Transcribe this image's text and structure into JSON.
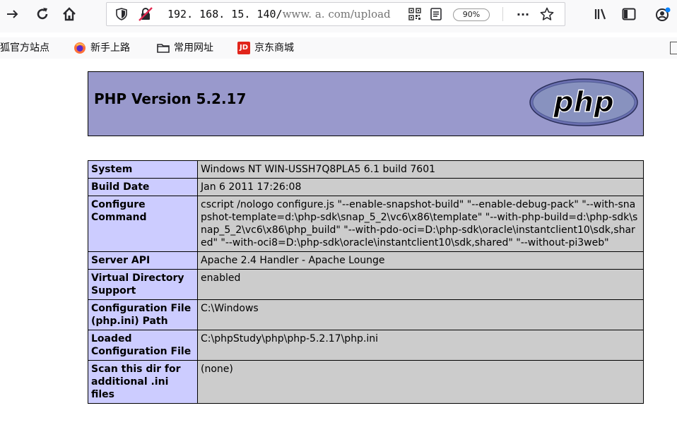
{
  "toolbar": {
    "url_host": "192. 168. 15. 140/",
    "url_path": "www. a. com/upload",
    "zoom": "90%",
    "more_label": "···"
  },
  "bookmarks": [
    {
      "label": "狐官方站点",
      "icon": "none"
    },
    {
      "label": "新手上路",
      "icon": "firefox-icon"
    },
    {
      "label": "常用网址",
      "icon": "folder-icon"
    },
    {
      "label": "京东商城",
      "icon": "jd-icon",
      "badge": "JD"
    }
  ],
  "phpinfo": {
    "title": "PHP Version 5.2.17",
    "logo_text": "php",
    "rows": [
      {
        "key": "System",
        "value": "Windows NT WIN-USSH7Q8PLA5 6.1 build 7601"
      },
      {
        "key": "Build Date",
        "value": "Jan 6 2011 17:26:08"
      },
      {
        "key": "Configure Command",
        "value": "cscript /nologo configure.js \"--enable-snapshot-build\" \"--enable-debug-pack\" \"--with-snapshot-template=d:\\php-sdk\\snap_5_2\\vc6\\x86\\template\" \"--with-php-build=d:\\php-sdk\\snap_5_2\\vc6\\x86\\php_build\" \"--with-pdo-oci=D:\\php-sdk\\oracle\\instantclient10\\sdk,shared\" \"--with-oci8=D:\\php-sdk\\oracle\\instantclient10\\sdk,shared\" \"--without-pi3web\""
      },
      {
        "key": "Server API",
        "value": "Apache 2.4 Handler - Apache Lounge"
      },
      {
        "key": "Virtual Directory Support",
        "value": "enabled"
      },
      {
        "key": "Configuration File (php.ini) Path",
        "value": "C:\\Windows"
      },
      {
        "key": "Loaded Configuration File",
        "value": "C:\\phpStudy\\php\\php-5.2.17\\php.ini"
      },
      {
        "key": "Scan this dir for additional .ini files",
        "value": "(none)"
      }
    ]
  },
  "colors": {
    "header_bg": "#9999cc",
    "key_bg": "#ccccff",
    "value_bg": "#cccccc"
  }
}
